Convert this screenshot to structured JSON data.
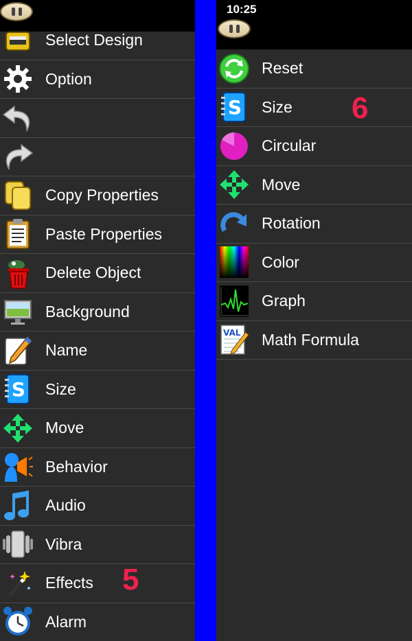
{
  "status_bar": {
    "time": "10:25"
  },
  "left_panel": {
    "items": [
      {
        "label": "Select Design",
        "icon": "select-design-icon"
      },
      {
        "label": "Option",
        "icon": "gear-icon"
      },
      {
        "label": "",
        "icon": "undo-icon"
      },
      {
        "label": "",
        "icon": "redo-icon"
      },
      {
        "label": "Copy Properties",
        "icon": "copy-icon"
      },
      {
        "label": "Paste Properties",
        "icon": "clipboard-icon"
      },
      {
        "label": "Delete Object",
        "icon": "trash-icon"
      },
      {
        "label": "Background",
        "icon": "monitor-icon"
      },
      {
        "label": "Name",
        "icon": "pen-icon"
      },
      {
        "label": "Size",
        "icon": "size-icon"
      },
      {
        "label": "Move",
        "icon": "move-arrows-icon"
      },
      {
        "label": "Behavior",
        "icon": "behavior-icon"
      },
      {
        "label": "Audio",
        "icon": "music-note-icon"
      },
      {
        "label": "Vibra",
        "icon": "vibration-icon"
      },
      {
        "label": "Effects",
        "icon": "magic-wand-icon"
      },
      {
        "label": "Alarm",
        "icon": "alarm-clock-icon"
      }
    ],
    "step_number": "5"
  },
  "right_panel": {
    "items": [
      {
        "label": "Reset",
        "icon": "reset-icon"
      },
      {
        "label": "Size",
        "icon": "size-icon"
      },
      {
        "label": "Circular",
        "icon": "pie-icon"
      },
      {
        "label": "Move",
        "icon": "move-arrows-icon"
      },
      {
        "label": "Rotation",
        "icon": "rotate-icon"
      },
      {
        "label": "Color",
        "icon": "color-spectrum-icon"
      },
      {
        "label": "Graph",
        "icon": "graph-icon"
      },
      {
        "label": "Math Formula",
        "icon": "math-formula-icon"
      }
    ],
    "step_number": "6"
  },
  "colors": {
    "panel_bg": "#2b2b2b",
    "divider": "#0000ff",
    "step_number": "#f0204f"
  }
}
